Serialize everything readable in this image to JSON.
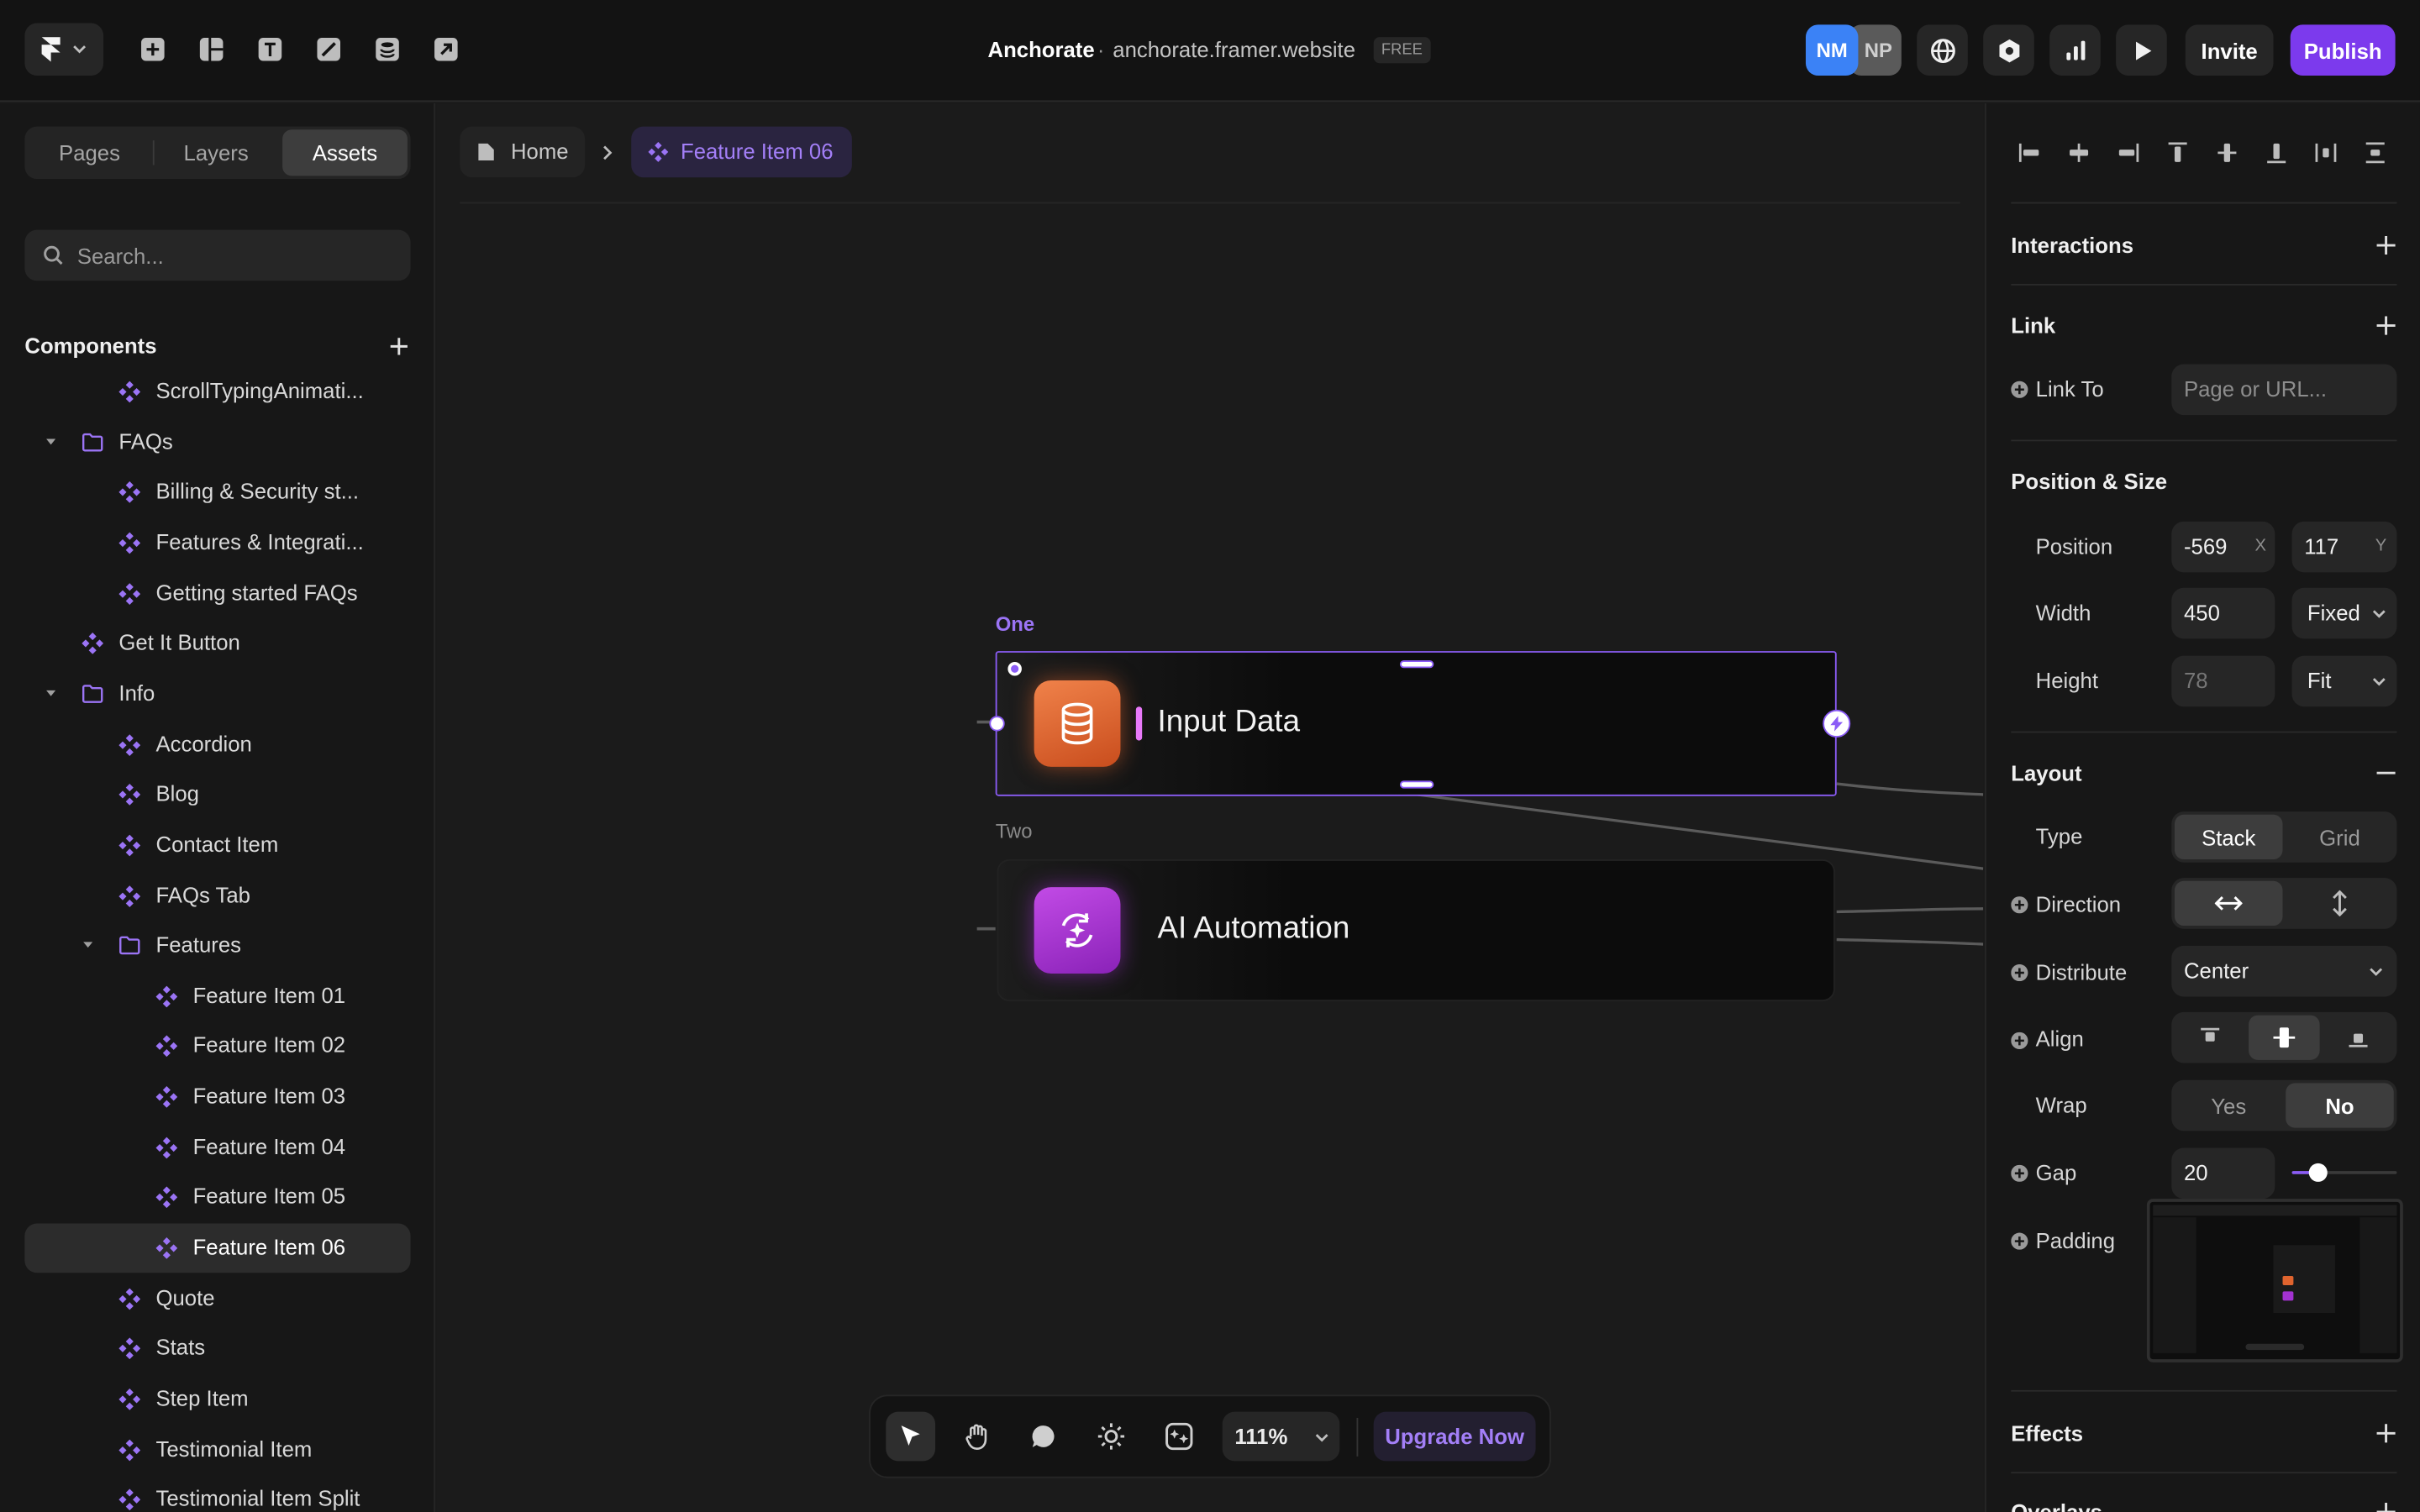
{
  "topbar": {
    "project_name": "Anchorate",
    "separator": "·",
    "site_url": "anchorate.framer.website",
    "plan_badge": "FREE",
    "avatars": [
      "NM",
      "NP"
    ],
    "invite_label": "Invite",
    "publish_label": "Publish"
  },
  "left": {
    "tabs": [
      "Pages",
      "Layers",
      "Assets"
    ],
    "active_tab": "Assets",
    "search_placeholder": "Search...",
    "components_title": "Components",
    "tree": [
      {
        "label": "ScrollTypingAnimati...",
        "type": "component"
      },
      {
        "label": "FAQs",
        "type": "folder"
      },
      {
        "label": "Billing & Security st...",
        "type": "component"
      },
      {
        "label": "Features & Integrati...",
        "type": "component"
      },
      {
        "label": "Getting started FAQs",
        "type": "component"
      },
      {
        "label": "Get It Button",
        "type": "component"
      },
      {
        "label": "Info",
        "type": "folder"
      },
      {
        "label": "Accordion",
        "type": "component"
      },
      {
        "label": "Blog",
        "type": "component"
      },
      {
        "label": "Contact Item",
        "type": "component"
      },
      {
        "label": "FAQs Tab",
        "type": "component"
      },
      {
        "label": "Features",
        "type": "folder"
      },
      {
        "label": "Feature Item 01",
        "type": "component"
      },
      {
        "label": "Feature Item 02",
        "type": "component"
      },
      {
        "label": "Feature Item 03",
        "type": "component"
      },
      {
        "label": "Feature Item 04",
        "type": "component"
      },
      {
        "label": "Feature Item 05",
        "type": "component"
      },
      {
        "label": "Feature Item 06",
        "type": "component",
        "selected": true
      },
      {
        "label": "Quote",
        "type": "component"
      },
      {
        "label": "Stats",
        "type": "component"
      },
      {
        "label": "Step Item",
        "type": "component"
      },
      {
        "label": "Testimonial Item",
        "type": "component"
      },
      {
        "label": "Testimonial Item Split",
        "type": "component"
      }
    ]
  },
  "canvas": {
    "breadcrumb_home": "Home",
    "breadcrumb_current": "Feature Item 06",
    "variant_one_label": "One",
    "variant_two_label": "Two",
    "card_one_text": "Input Data",
    "card_two_text": "AI Automation"
  },
  "toolbar": {
    "zoom": "111%",
    "upgrade_label": "Upgrade Now"
  },
  "right": {
    "interactions_title": "Interactions",
    "link_title": "Link",
    "link_to_label": "Link To",
    "link_placeholder": "Page or URL...",
    "position_size_title": "Position & Size",
    "position_label": "Position",
    "pos_x": "-569",
    "pos_x_unit": "X",
    "pos_y": "117",
    "pos_y_unit": "Y",
    "width_label": "Width",
    "width_value": "450",
    "width_mode": "Fixed",
    "height_label": "Height",
    "height_value": "78",
    "height_mode": "Fit",
    "layout_title": "Layout",
    "type_label": "Type",
    "type_options": [
      "Stack",
      "Grid"
    ],
    "type_selected": "Stack",
    "direction_label": "Direction",
    "distribute_label": "Distribute",
    "distribute_value": "Center",
    "align_label": "Align",
    "wrap_label": "Wrap",
    "wrap_options": [
      "Yes",
      "No"
    ],
    "wrap_selected": "No",
    "gap_label": "Gap",
    "gap_value": "20",
    "gap_slider_fraction": 0.25,
    "padding_label": "Padding",
    "effects_title": "Effects",
    "overlays_title": "Overlays"
  },
  "colors": {
    "accent": "#8b5cf6",
    "publish": "#7c3aed",
    "avatar_nm": "#3b82f6",
    "avatar_np": "#6b6b6b",
    "card_one_icon": "#e0642e",
    "card_two_icon": "#a332d1"
  }
}
